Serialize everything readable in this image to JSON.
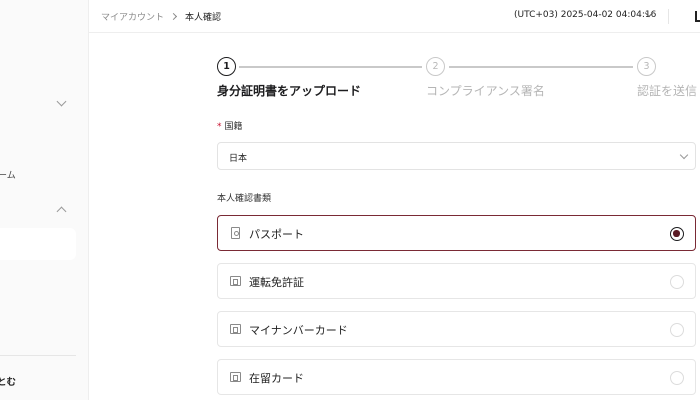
{
  "sidebar": {
    "item_partial": "ーム",
    "bottom_partial": "とむ"
  },
  "header": {
    "breadcrumb": {
      "parent": "マイアカウント",
      "current": "本人確認"
    },
    "timezone_datetime": "(UTC+03)  2025-04-02 04:04:16"
  },
  "stepper": {
    "steps": [
      {
        "number": "1",
        "label": "身分証明書をアップロード",
        "state": "active"
      },
      {
        "number": "2",
        "label": "コンプライアンス署名",
        "state": "inactive"
      },
      {
        "number": "3",
        "label": "認証を送信",
        "state": "inactive"
      }
    ]
  },
  "form": {
    "nationality": {
      "required_mark": "*",
      "label": "国籍",
      "value": "日本"
    },
    "document_type": {
      "label": "本人確認書類",
      "options": [
        {
          "label": "パスポート",
          "icon": "passport-icon",
          "selected": true
        },
        {
          "label": "運転免許証",
          "icon": "id-card-icon",
          "selected": false
        },
        {
          "label": "マイナンバーカード",
          "icon": "id-card-icon",
          "selected": false
        },
        {
          "label": "在留カード",
          "icon": "id-card-icon",
          "selected": false
        }
      ]
    }
  },
  "colors": {
    "selected_border": "#7a2a35",
    "radio_fill": "#5a1a24",
    "required": "#c8102e"
  }
}
